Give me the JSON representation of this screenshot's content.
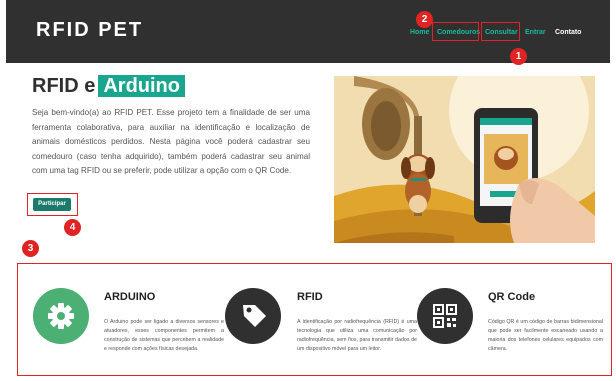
{
  "header": {
    "brand": "RFID PET",
    "nav": [
      {
        "label": "Home"
      },
      {
        "label": "Comedouros"
      },
      {
        "label": "Consultar"
      },
      {
        "label": "Entrar"
      },
      {
        "label": "Contato"
      }
    ]
  },
  "annotations": [
    "1",
    "2",
    "3",
    "4"
  ],
  "hero": {
    "title_prefix": "RFID e",
    "title_highlight": "Arduino",
    "text": "Seja bem-vindo(a) ao RFID PET. Esse projeto tem a finalidade de ser uma ferramenta colaborativa, para auxiliar na identificação e localização de animais domésticos perdidos. Nesta página você poderá cadastrar seu comedouro (caso tenha adquirido), também poderá cadastrar seu animal com uma tag RFID ou se preferir, pode utilizar a opção com o QR Code.",
    "button": "Participar"
  },
  "features": [
    {
      "title": "ARDUINO",
      "icon": "gear-icon",
      "text": "O Arduino pode ser ligado a diversos sensores e atuadores, esses componentes permitem a construção de sistemas que percebem a realidade e responde com ações físicas desejada."
    },
    {
      "title": "RFID",
      "icon": "tag-icon",
      "text": "A identificação por radiofrequência (RFID) é uma tecnologia que utiliza uma comunicação por radiofrequência, sem fios, para transmitir dados de um dispositivo móvel para um leitor."
    },
    {
      "title": "QR Code",
      "icon": "qrcode-icon",
      "text": "Código QR é um código de barras bidimensional que pode ser facilmente escaneado usando a maioria dos telefones celulares equipados com câmera."
    }
  ],
  "colors": {
    "header_bg": "#303030",
    "accent": "#1aa58e",
    "nav_link": "#1cb89c",
    "button": "#1b7a6b",
    "annotation": "#e02424",
    "arduino_icon": "#4caf73",
    "rfid_icon": "#303030",
    "qr_icon": "#303030"
  }
}
